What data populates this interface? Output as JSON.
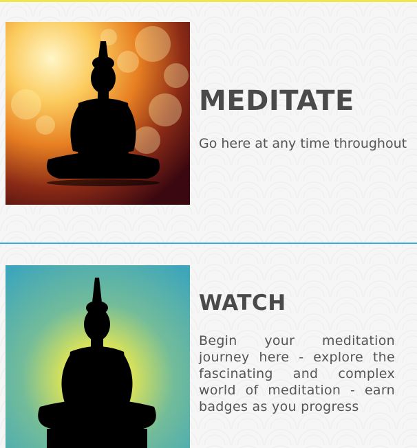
{
  "colors": {
    "top_rule": "#f2e64e",
    "divider": "#36a9e1",
    "heading": "#4a4a4a",
    "text": "#555555"
  },
  "sections": [
    {
      "title": "MEDITATE",
      "description": "Go here at any time throughout",
      "image_icon": "buddha-silhouette-bokeh-icon"
    },
    {
      "title": "WATCH",
      "description": "Begin your meditation journey here - explore the fascinating and complex world of meditation - earn badges as you progress",
      "image_icon": "buddha-silhouette-glow-icon"
    }
  ]
}
